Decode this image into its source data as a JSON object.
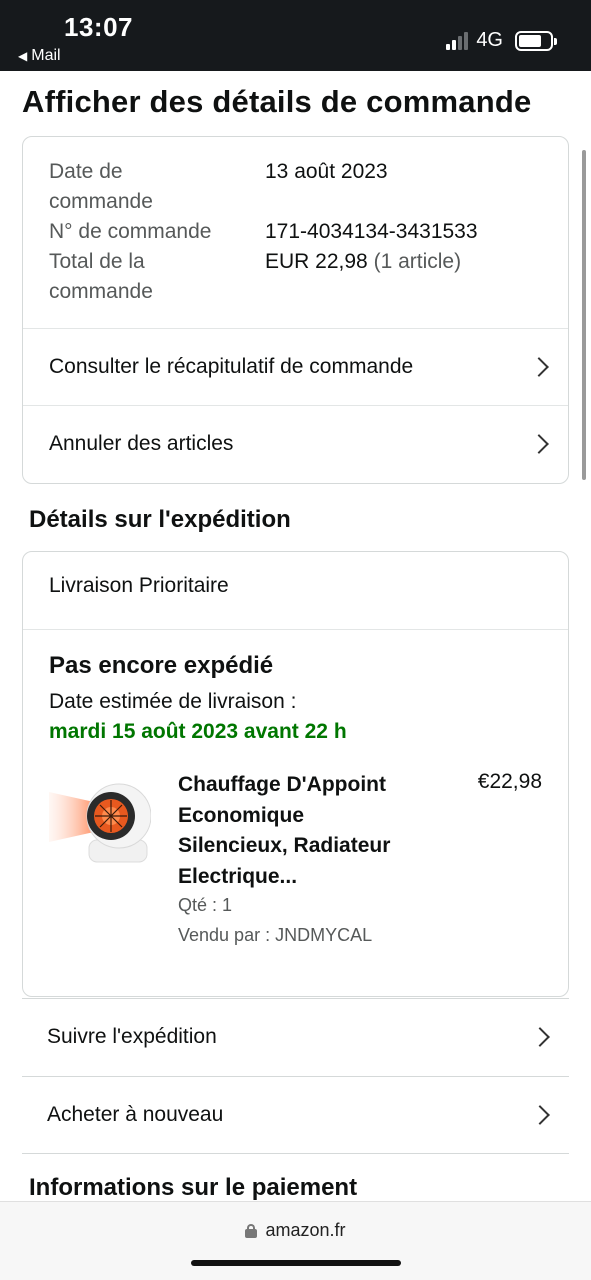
{
  "status_bar": {
    "time": "13:07",
    "back_label": "Mail",
    "network": "4G"
  },
  "page": {
    "title": "Afficher des détails de commande"
  },
  "order": {
    "date_label_1": "Date de",
    "date_label_2": "commande",
    "date_value": "13 août 2023",
    "number_label": "N° de commande",
    "number_value": "171-4034134-3431533",
    "total_label_1": "Total de la",
    "total_label_2": "commande",
    "total_value": "EUR 22,98",
    "total_count": "(1 article)",
    "summary_link": "Consulter le récapitulatif de commande",
    "cancel_link": "Annuler des articles"
  },
  "shipping": {
    "section_title": "Détails sur l'expédition",
    "method": "Livraison Prioritaire",
    "status": "Pas encore expédié",
    "estimate_label": "Date estimée de livraison :",
    "estimate_date": "mardi 15 août 2023 avant 22 h",
    "product": {
      "title_1": "Chauffage D'Appoint",
      "title_2": "Economique",
      "title_3": "Silencieux, Radiateur",
      "title_4": "Electrique...",
      "price": "€22,98",
      "qty": "Qté : 1",
      "seller": "Vendu par : JNDMYCAL"
    },
    "track_link": "Suivre l'expédition",
    "buy_again_link": "Acheter à nouveau"
  },
  "payment": {
    "section_title": "Informations sur le paiement"
  },
  "browser": {
    "url": "amazon.fr"
  },
  "colors": {
    "accent_green": "#007600",
    "status_bar_bg": "#16191c"
  }
}
